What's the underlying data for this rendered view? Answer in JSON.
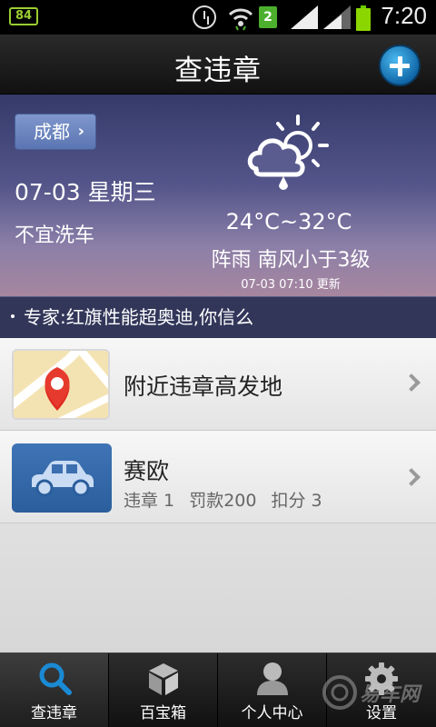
{
  "status_bar": {
    "battery_left": "84",
    "sim_badge": "2",
    "time": "7:20"
  },
  "header": {
    "title": "查违章"
  },
  "weather": {
    "city": "成都",
    "date": "07-03 星期三",
    "advice": "不宜洗车",
    "temperature": "24°C~32°C",
    "condition": "阵雨 南风小于3级",
    "updated": "07-03 07:10 更新"
  },
  "news": {
    "headline": "专家:红旗性能超奥迪,你信么"
  },
  "list": {
    "nearby": {
      "title": "附近违章高发地"
    },
    "car": {
      "name": "赛欧",
      "violations": "违章 1",
      "fine": "罚款200",
      "points": "扣分 3"
    }
  },
  "tabs": [
    {
      "label": "查违章",
      "icon": "search-icon",
      "active": true
    },
    {
      "label": "百宝箱",
      "icon": "box-icon",
      "active": false
    },
    {
      "label": "个人中心",
      "icon": "person-icon",
      "active": false
    },
    {
      "label": "设置",
      "icon": "gear-icon",
      "active": false
    }
  ],
  "watermark": {
    "text": "易车网"
  },
  "colors": {
    "accent_blue": "#1a8ad4",
    "title_bar": "#1b1b1b",
    "battery_green": "#8bd600"
  }
}
